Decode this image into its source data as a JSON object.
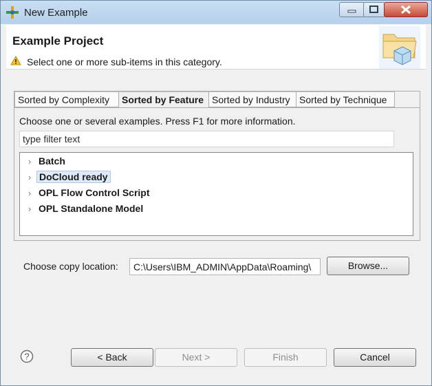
{
  "window": {
    "title": "New Example"
  },
  "header": {
    "title": "Example Project",
    "message": "Select one or more sub-items in this category."
  },
  "tabs": [
    {
      "label": "Sorted by Complexity"
    },
    {
      "label": "Sorted by Feature",
      "active": true
    },
    {
      "label": "Sorted by Industry"
    },
    {
      "label": "Sorted by Technique"
    }
  ],
  "panel": {
    "hint": "Choose one or several examples. Press F1 for more information.",
    "filter_value": "type filter text"
  },
  "tree": {
    "items": [
      {
        "label": "Batch"
      },
      {
        "label": "DoCloud ready",
        "selected": true
      },
      {
        "label": "OPL Flow Control Script"
      },
      {
        "label": "OPL Standalone Model"
      }
    ]
  },
  "location": {
    "label": "Choose copy location:",
    "value": "C:\\Users\\IBM_ADMIN\\AppData\\Roaming\\",
    "browse": "Browse..."
  },
  "buttons": {
    "back": "< Back",
    "next": "Next >",
    "finish": "Finish",
    "cancel": "Cancel"
  },
  "colors": {
    "selection": "#dfeaf8",
    "accent": "#1f5fa8"
  }
}
